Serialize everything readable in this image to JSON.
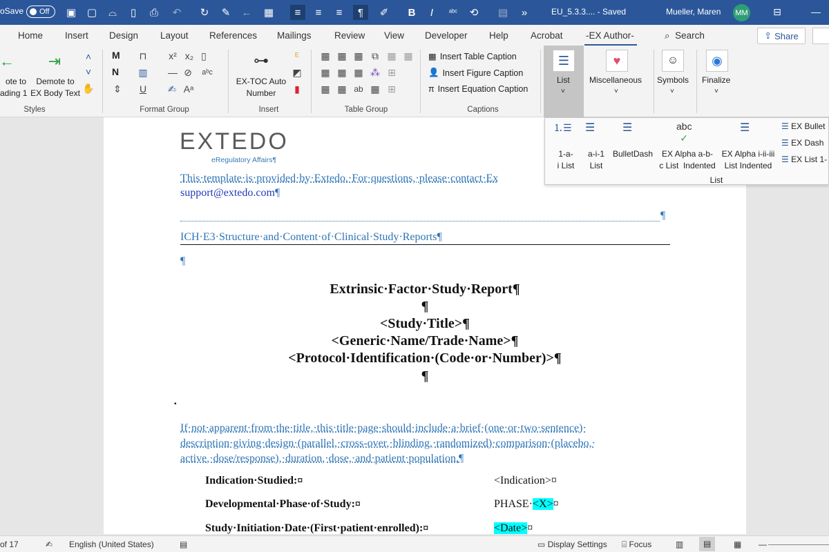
{
  "titlebar": {
    "autosave_label": "oSave",
    "autosave_state": "Off",
    "doc_title": "EU_5.3.3....  -  Saved",
    "user_name": "Mueller, Maren",
    "user_initials": "MM",
    "more_glyph": "»"
  },
  "tabs": [
    "Home",
    "Insert",
    "Design",
    "Layout",
    "References",
    "Mailings",
    "Review",
    "View",
    "Developer",
    "Help",
    "Acrobat",
    "-EX Author-"
  ],
  "search_label": "Search",
  "share_label": "Share",
  "ribbon": {
    "styles": {
      "promote_label": "ote to\nading 1",
      "demote_label": "Demote to\nEX Body Text",
      "group_label": "Styles"
    },
    "format": {
      "group_label": "Format Group",
      "m_label": "M",
      "n_label": "N"
    },
    "insert": {
      "toc_label": "EX-TOC Auto\nNumber",
      "group_label": "Insert"
    },
    "table": {
      "group_label": "Table Group"
    },
    "captions": {
      "table_caption": "Insert Table Caption",
      "figure_caption": "Insert Figure Caption",
      "equation_caption": "Insert Equation Caption",
      "group_label": "Captions"
    },
    "list_label": "List",
    "misc_label": "Miscellaneous",
    "symbols_label": "Symbols",
    "finalize_label": "Finalize"
  },
  "list_gallery": {
    "items": [
      {
        "label": "1-a-\ni List"
      },
      {
        "label": "a-i-1\nList"
      },
      {
        "label": "BulletDash"
      },
      {
        "label": "EX Alpha a-b-\nc List  Indented"
      },
      {
        "label": "EX Alpha i-ii-iii\nList Indented"
      }
    ],
    "side_items": [
      "EX Bullet",
      "EX Dash",
      "EX List 1-"
    ],
    "group_label": "List",
    "abc_label": "abc"
  },
  "document": {
    "logo_text": "EXTEDO",
    "logo_sub": "eRegulatory Affairs",
    "template_note_1": "This·template·is·provided·by·Extedo.·For·questions,·please·contact·Ex",
    "template_note_2": "support@extedo.com",
    "ich_line": "ICH·E3·Structure·and·Content·of·Clinical·Study·Reports",
    "report_title": "Extrinsic·Factor·Study·Report",
    "study_title": "<Study·Title>",
    "generic_name": "<Generic·Name/Trade·Name>",
    "protocol_id": "<Protocol·Identification·(Code·or·Number)>",
    "pilcrow": "¶",
    "cell_mark": "¤",
    "bullet": "▪",
    "description_1": "If·not·apparent·from·the·title,·this·title·page·should·include·a·brief·(one·or·two·sentence)·",
    "description_2": "description·giving·design·(parallel,·cross-over,·blinding,·randomized)·comparison·(placebo,·",
    "description_3": "active,·dose/response),·duration,·dose,·and·patient·population.",
    "rows": [
      {
        "label": "Indication·Studied:",
        "value": "<Indication>",
        "highlight": ""
      },
      {
        "label": "Developmental·Phase·of·Study:",
        "value": "PHASE·",
        "highlight": "<X>"
      },
      {
        "label": "Study·Initiation·Date·(First·patient·enrolled):",
        "value": "",
        "highlight": "<Date>"
      }
    ]
  },
  "statusbar": {
    "page_info": "of 17",
    "language": "English (United States)",
    "display_settings": "Display Settings",
    "focus": "Focus"
  },
  "colors": {
    "titlebar_bg": "#2b579a",
    "avatar_bg": "#2f9e77",
    "doc_blue": "#2e74b5",
    "highlight": "#00ffff"
  }
}
